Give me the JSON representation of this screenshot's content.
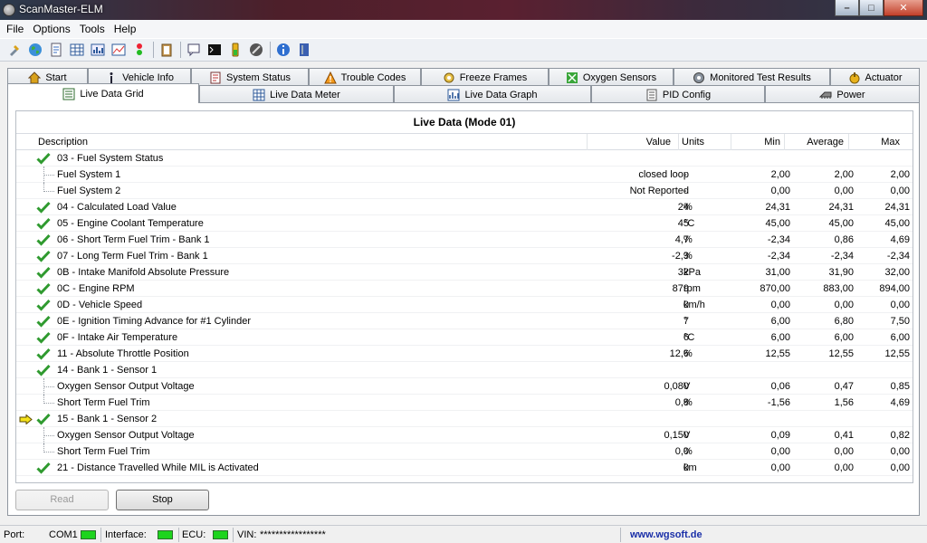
{
  "window": {
    "title": "ScanMaster-ELM",
    "min": "–",
    "max": "□",
    "close": "✕"
  },
  "menu": [
    "File",
    "Options",
    "Tools",
    "Help"
  ],
  "toolbar_icons": [
    "connect-icon",
    "globe-icon",
    "document-icon",
    "grid-icon",
    "meter-icon",
    "chart-icon",
    "status-icon",
    "clipboard-icon",
    "message-icon",
    "terminal-icon",
    "battery-icon",
    "stop-icon",
    "info-icon",
    "book-icon"
  ],
  "tabs_row1": [
    {
      "label": "Start",
      "icon": "start-icon"
    },
    {
      "label": "Vehicle Info",
      "icon": "info-icon"
    },
    {
      "label": "System Status",
      "icon": "status-icon"
    },
    {
      "label": "Trouble Codes",
      "icon": "warning-icon"
    },
    {
      "label": "Freeze Frames",
      "icon": "freeze-icon"
    },
    {
      "label": "Oxygen Sensors",
      "icon": "sensor-icon"
    },
    {
      "label": "Monitored Test Results",
      "icon": "gear-icon"
    },
    {
      "label": "Actuator",
      "icon": "actuator-icon"
    }
  ],
  "tabs_row2": [
    {
      "label": "Live Data Grid",
      "icon": "grid-icon",
      "active": true
    },
    {
      "label": "Live Data Meter",
      "icon": "meter-icon"
    },
    {
      "label": "Live Data Graph",
      "icon": "graph-icon"
    },
    {
      "label": "PID Config",
      "icon": "config-icon"
    },
    {
      "label": "Power",
      "icon": "power-icon"
    }
  ],
  "grid": {
    "title": "Live Data (Mode 01)",
    "headers": {
      "description": "Description",
      "value": "Value",
      "units": "Units",
      "min": "Min",
      "average": "Average",
      "max": "Max"
    },
    "rows": [
      {
        "desc": "03 - Fuel System Status",
        "check": true,
        "sub": false,
        "value": "",
        "unit": "",
        "min": "",
        "avg": "",
        "max": ""
      },
      {
        "desc": "Fuel System 1",
        "check": false,
        "sub": true,
        "value": "closed loop",
        "unit": "-",
        "min": "2,00",
        "avg": "2,00",
        "max": "2,00"
      },
      {
        "desc": "Fuel System 2",
        "check": false,
        "sub": true,
        "value": "Not Reported",
        "unit": "-",
        "min": "0,00",
        "avg": "0,00",
        "max": "0,00"
      },
      {
        "desc": "04 - Calculated Load Value",
        "check": true,
        "sub": false,
        "value": "24",
        "unit": "%",
        "min": "24,31",
        "avg": "24,31",
        "max": "24,31"
      },
      {
        "desc": "05 - Engine Coolant Temperature",
        "check": true,
        "sub": false,
        "value": "45",
        "unit": "°C",
        "min": "45,00",
        "avg": "45,00",
        "max": "45,00"
      },
      {
        "desc": "06 - Short Term Fuel Trim - Bank 1",
        "check": true,
        "sub": false,
        "value": "4,7",
        "unit": "%",
        "min": "-2,34",
        "avg": "0,86",
        "max": "4,69"
      },
      {
        "desc": "07 - Long Term Fuel Trim - Bank 1",
        "check": true,
        "sub": false,
        "value": "-2,3",
        "unit": "%",
        "min": "-2,34",
        "avg": "-2,34",
        "max": "-2,34"
      },
      {
        "desc": "0B - Intake Manifold Absolute Pressure",
        "check": true,
        "sub": false,
        "value": "32",
        "unit": "kPa",
        "min": "31,00",
        "avg": "31,90",
        "max": "32,00"
      },
      {
        "desc": "0C - Engine RPM",
        "check": true,
        "sub": false,
        "value": "879",
        "unit": "rpm",
        "min": "870,00",
        "avg": "883,00",
        "max": "894,00"
      },
      {
        "desc": "0D - Vehicle Speed",
        "check": true,
        "sub": false,
        "value": "0",
        "unit": "km/h",
        "min": "0,00",
        "avg": "0,00",
        "max": "0,00"
      },
      {
        "desc": "0E - Ignition Timing Advance for #1 Cylinder",
        "check": true,
        "sub": false,
        "value": "7",
        "unit": "°",
        "min": "6,00",
        "avg": "6,80",
        "max": "7,50"
      },
      {
        "desc": "0F - Intake Air Temperature",
        "check": true,
        "sub": false,
        "value": "6",
        "unit": "°C",
        "min": "6,00",
        "avg": "6,00",
        "max": "6,00"
      },
      {
        "desc": "11 - Absolute Throttle Position",
        "check": true,
        "sub": false,
        "value": "12,6",
        "unit": "%",
        "min": "12,55",
        "avg": "12,55",
        "max": "12,55"
      },
      {
        "desc": "14 - Bank 1 - Sensor 1",
        "check": true,
        "sub": false,
        "value": "",
        "unit": "",
        "min": "",
        "avg": "",
        "max": ""
      },
      {
        "desc": "Oxygen Sensor Output Voltage",
        "check": false,
        "sub": true,
        "value": "0,080",
        "unit": "V",
        "min": "0,06",
        "avg": "0,47",
        "max": "0,85"
      },
      {
        "desc": "Short Term Fuel Trim",
        "check": false,
        "sub": true,
        "value": "0,8",
        "unit": "%",
        "min": "-1,56",
        "avg": "1,56",
        "max": "4,69"
      },
      {
        "desc": "15 - Bank 1 - Sensor 2",
        "check": true,
        "sub": false,
        "pointer": true,
        "value": "",
        "unit": "",
        "min": "",
        "avg": "",
        "max": ""
      },
      {
        "desc": "Oxygen Sensor Output Voltage",
        "check": false,
        "sub": true,
        "value": "0,150",
        "unit": "V",
        "min": "0,09",
        "avg": "0,41",
        "max": "0,82"
      },
      {
        "desc": "Short Term Fuel Trim",
        "check": false,
        "sub": true,
        "value": "0,0",
        "unit": "%",
        "min": "0,00",
        "avg": "0,00",
        "max": "0,00"
      },
      {
        "desc": "21 - Distance Travelled While MIL is Activated",
        "check": true,
        "sub": false,
        "value": "0",
        "unit": "km",
        "min": "0,00",
        "avg": "0,00",
        "max": "0,00"
      }
    ]
  },
  "buttons": {
    "read": "Read",
    "stop": "Stop"
  },
  "status": {
    "port_label": "Port:",
    "port_value": "COM1",
    "interface_label": "Interface:",
    "ecu_label": "ECU:",
    "vin_label": "VIN:",
    "vin_value": "*****************",
    "link": "www.wgsoft.de",
    "led_color": "#1ed41e"
  }
}
